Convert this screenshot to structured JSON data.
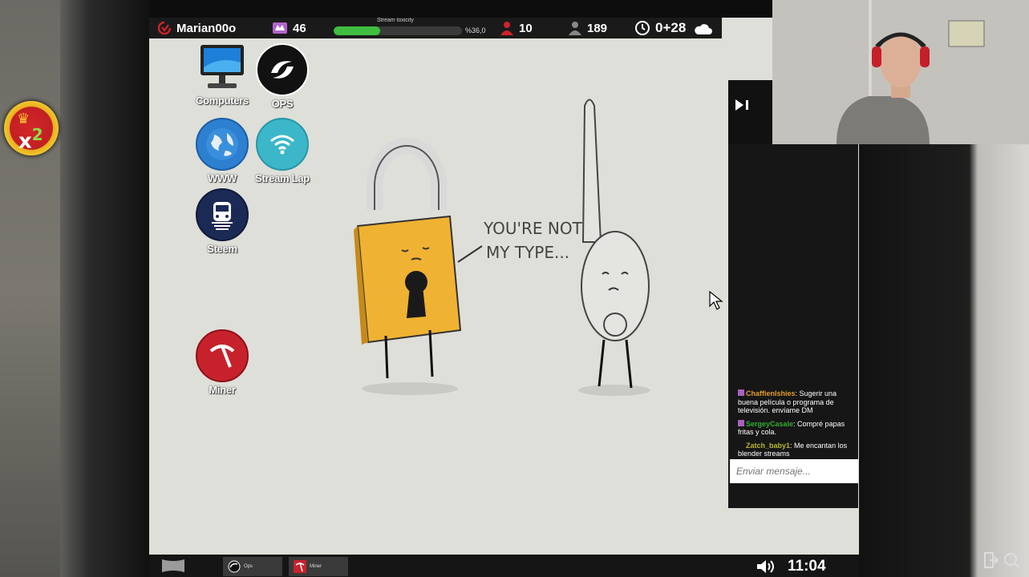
{
  "hud": {
    "username": "Marian00o",
    "level": "46",
    "toxicity_label": "Stream toxicity",
    "toxicity_percent": "%36,0",
    "toxicity_fraction": 0.36,
    "subscribers": "10",
    "viewers": "189",
    "time": "0+28"
  },
  "badge": {
    "multiplier": "x",
    "multiplier_num": "2"
  },
  "desktop_icons": [
    {
      "label": "Computers"
    },
    {
      "label": "OPS"
    },
    {
      "label": "WWW"
    },
    {
      "label": "Stream Lap"
    },
    {
      "label": "Steem"
    },
    {
      "label": "Miner"
    }
  ],
  "wallpaper": {
    "caption_line1": "YOU'RE NOT",
    "caption_line2": "MY TYPE..."
  },
  "chat": {
    "messages": [
      {
        "user": "Chaffienlshies",
        "text": ": Sugerir una buena película o programa de televisión. envíame DM",
        "color": "#e39c2d"
      },
      {
        "user": "SergeyCasale",
        "text": ": Compré papas fritas y cola.",
        "color": "#2fae2f"
      },
      {
        "user": "Zatch_baby1",
        "text": ": Me encantan los blender streams",
        "color": "#b7b72a"
      }
    ],
    "input_placeholder": "Enviar mensaje..."
  },
  "taskbar": {
    "tasks": [
      {
        "label": "Ops"
      },
      {
        "label": "Miner"
      }
    ],
    "clock": "11:04"
  },
  "colors": {
    "topbar": "#1a1a1a",
    "toxicity": "#3fbe3f",
    "desktop": "#dedfd8"
  }
}
